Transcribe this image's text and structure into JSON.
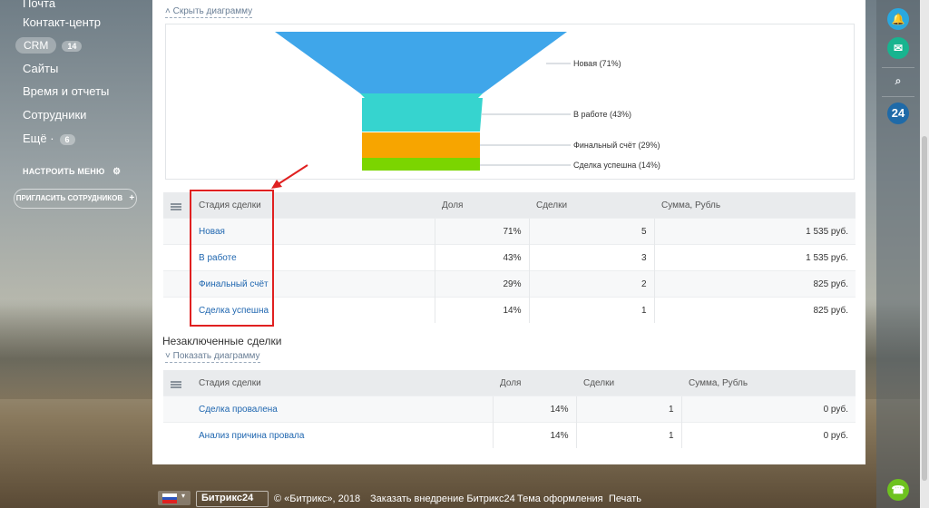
{
  "sidebar": {
    "items": [
      {
        "label": "Почта"
      },
      {
        "label": "Контакт-центр"
      },
      {
        "label": "CRM",
        "badge": "14"
      },
      {
        "label": "Сайты"
      },
      {
        "label": "Время и отчеты"
      },
      {
        "label": "Сотрудники"
      },
      {
        "label": "Ещё ·",
        "badge": "6"
      }
    ],
    "setup_label": "НАСТРОИТЬ МЕНЮ",
    "invite_label": "ПРИГЛАСИТЬ СОТРУДНИКОВ"
  },
  "funnel_section": {
    "hide_label": "Скрыть диаграмму",
    "stages": [
      {
        "label": "Новая (71%)",
        "color": "#3fa6ea"
      },
      {
        "label": "В работе (43%)",
        "color": "#36d4cf"
      },
      {
        "label": "Финальный счёт (29%)",
        "color": "#f7a500"
      },
      {
        "label": "Сделка успешна (14%)",
        "color": "#7bd500"
      }
    ]
  },
  "deals_table": {
    "headers": [
      "Стадия сделки",
      "Доля",
      "Сделки",
      "Сумма, Рубль"
    ],
    "rows": [
      {
        "stage": "Новая",
        "share": "71%",
        "deals": "5",
        "sum": "1 535 руб."
      },
      {
        "stage": "В работе",
        "share": "43%",
        "deals": "3",
        "sum": "1 535 руб."
      },
      {
        "stage": "Финальный счёт",
        "share": "29%",
        "deals": "2",
        "sum": "825 руб."
      },
      {
        "stage": "Сделка успешна",
        "share": "14%",
        "deals": "1",
        "sum": "825 руб."
      }
    ]
  },
  "lost_section": {
    "title": "Незаключенные сделки",
    "show_label": "Показать диаграмму",
    "headers": [
      "Стадия сделки",
      "Доля",
      "Сделки",
      "Сумма, Рубль"
    ],
    "rows": [
      {
        "stage": "Сделка провалена",
        "share": "14%",
        "deals": "1",
        "sum": "0 руб."
      },
      {
        "stage": "Анализ причина провала",
        "share": "14%",
        "deals": "1",
        "sum": "0 руб."
      }
    ]
  },
  "right_rail": {
    "logo_text": "24"
  },
  "footer": {
    "brand": "Битрикс24",
    "copyright": "© «Битрикс», 2018",
    "order": "Заказать внедрение Битрикс24",
    "theme": "Тема оформления",
    "print": "Печать"
  }
}
